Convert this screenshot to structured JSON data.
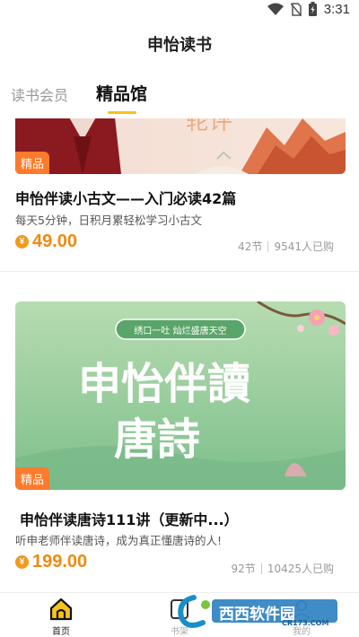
{
  "status_bar": {
    "time": "3:31"
  },
  "header": {
    "title": "申怡读书"
  },
  "tabs": [
    {
      "label": "读书会员",
      "active": false
    },
    {
      "label": "精品馆",
      "active": true
    }
  ],
  "colors": {
    "accent": "#f6c21c",
    "price": "#f08a10",
    "badge": "#ff7a2a"
  },
  "courses": [
    {
      "badge": "精品",
      "cover_text": "",
      "title": "申怡伴读小古文——入门必读42篇",
      "description": "每天5分钟，日积月累轻松学习小古文",
      "coin_icon": "coin-icon",
      "price": "49.00",
      "lessons": "42节",
      "buyers": "9541人已购"
    },
    {
      "badge": "精品",
      "cover_banner": "绣口一吐 灿烂盛唐天空",
      "cover_title_line1": "申怡伴讀",
      "cover_title_line2": "唐詩",
      "title": "申怡伴读唐诗111讲（更新中...）",
      "description": "听申老师伴读唐诗，成为真正懂唐诗的人!",
      "coin_icon": "coin-icon",
      "price": "199.00",
      "lessons": "92节",
      "buyers": "10425人已购"
    }
  ],
  "bottom_nav": [
    {
      "label": "首页",
      "icon": "home-icon",
      "active": true
    },
    {
      "label": "书架",
      "icon": "bookshelf-icon",
      "active": false
    },
    {
      "label": "我的",
      "icon": "profile-icon",
      "active": false
    }
  ],
  "watermark": {
    "text": "西西软件园",
    "url_text": "CR173.COM"
  }
}
